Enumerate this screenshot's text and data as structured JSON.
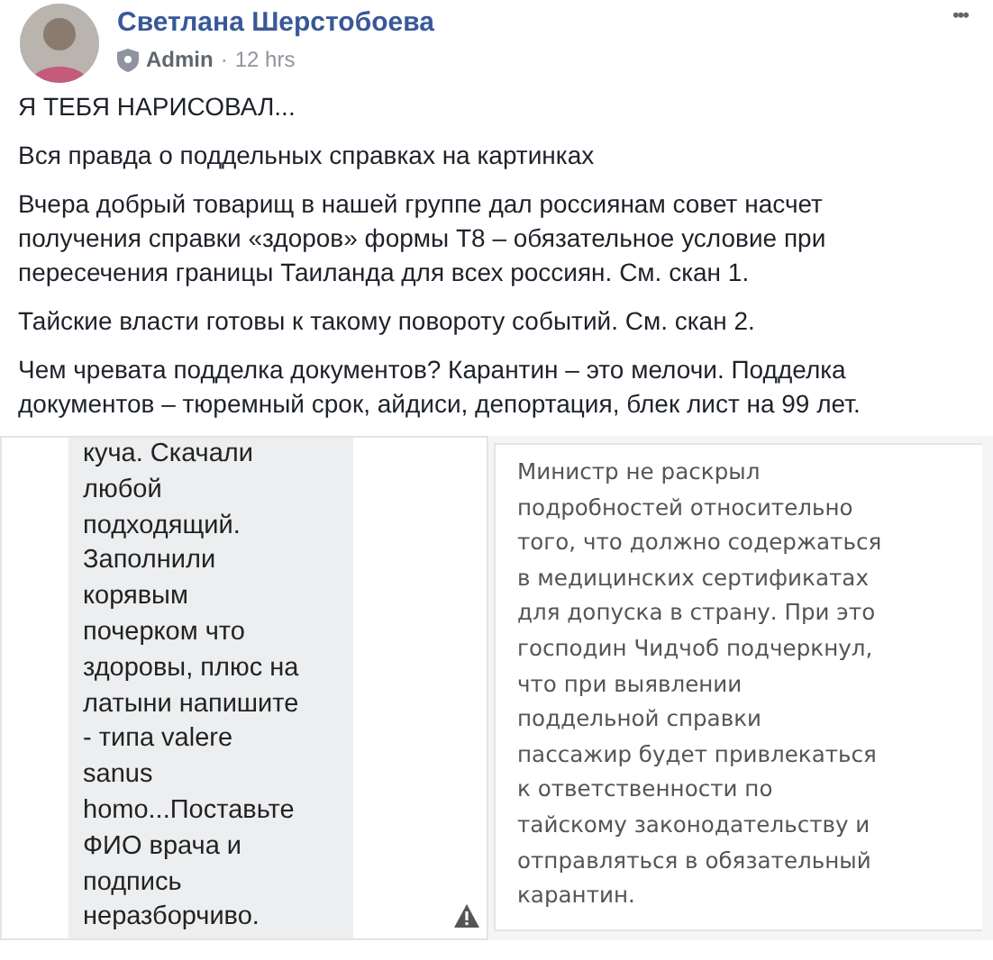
{
  "post": {
    "author": "Светлана Шерстобоева",
    "role": "Admin",
    "separator": "·",
    "time": "12 hrs",
    "menu": "•••",
    "paragraphs": [
      "Я ТЕБЯ НАРИСОВАЛ...",
      "Вся правда о поддельных справках на картинках",
      "Вчера добрый товарищ в нашей группе дал россиянам совет насчет получения справки «здоров» формы Т8 – обязательное условие при пересечения границы Таиланда для всех россиян. См. скан 1.",
      "Тайские власти готовы к такому повороту событий. См. скан 2.",
      "Чем чревата подделка документов? Карантин – это мелочи. Подделка документов – тюремный срок, айдиси, депортация, блек лист на 99 лет."
    ]
  },
  "scans": [
    {
      "kind": "chat",
      "lines": [
        "куча. Скачали",
        "любой",
        "подходящий.",
        "Заполнили",
        "корявым",
        "почерком что",
        "здоровы, плюс на",
        "латыни напишите",
        "- типа valere",
        "sanus",
        "homo...Поставьте",
        "ФИО врача и",
        "подпись",
        "неразборчиво."
      ],
      "warning": true
    },
    {
      "kind": "article",
      "lines": [
        "Министр не раскрыл",
        "подробностей относительно",
        "того, что должно содержаться",
        "в медицинских сертификатах",
        "для допуска в страну. При это",
        "господин Чидчоб подчеркнул,",
        "что при выявлении",
        "поддельной справки",
        "пассажир будет привлекаться",
        "к ответственности по",
        "тайскому законодательству и",
        "отправляться в обязательный",
        "карантин."
      ]
    }
  ]
}
